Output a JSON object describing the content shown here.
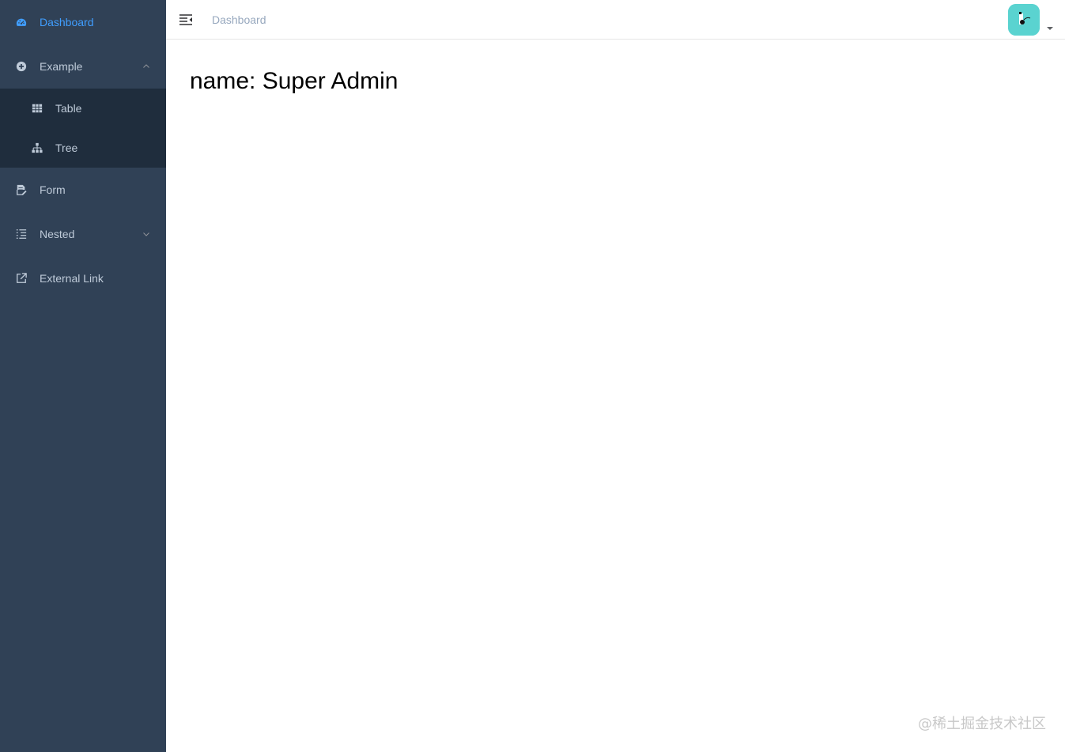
{
  "colors": {
    "sidebar_bg": "#304156",
    "submenu_bg": "#1f2d3d",
    "sidebar_text": "#bfcbd9",
    "active_text": "#409eff",
    "breadcrumb_text": "#97a8be",
    "avatar_bg": "#5ad3d0"
  },
  "sidebar": {
    "items": [
      {
        "label": "Dashboard",
        "icon": "dashboard-icon",
        "active": true
      },
      {
        "label": "Example",
        "icon": "plus-circle-icon",
        "expanded": true,
        "children": [
          {
            "label": "Table",
            "icon": "table-icon"
          },
          {
            "label": "Tree",
            "icon": "tree-icon"
          }
        ]
      },
      {
        "label": "Form",
        "icon": "form-icon"
      },
      {
        "label": "Nested",
        "icon": "nested-icon",
        "expanded": false
      },
      {
        "label": "External Link",
        "icon": "external-link-icon"
      }
    ]
  },
  "navbar": {
    "breadcrumb": "Dashboard",
    "hamburger_icon": "hamburger-icon",
    "avatar_icon": "avatar",
    "dropdown_icon": "caret-down-icon"
  },
  "main": {
    "dashboard_text": "name: Super Admin"
  },
  "watermark": "@稀土掘金技术社区"
}
